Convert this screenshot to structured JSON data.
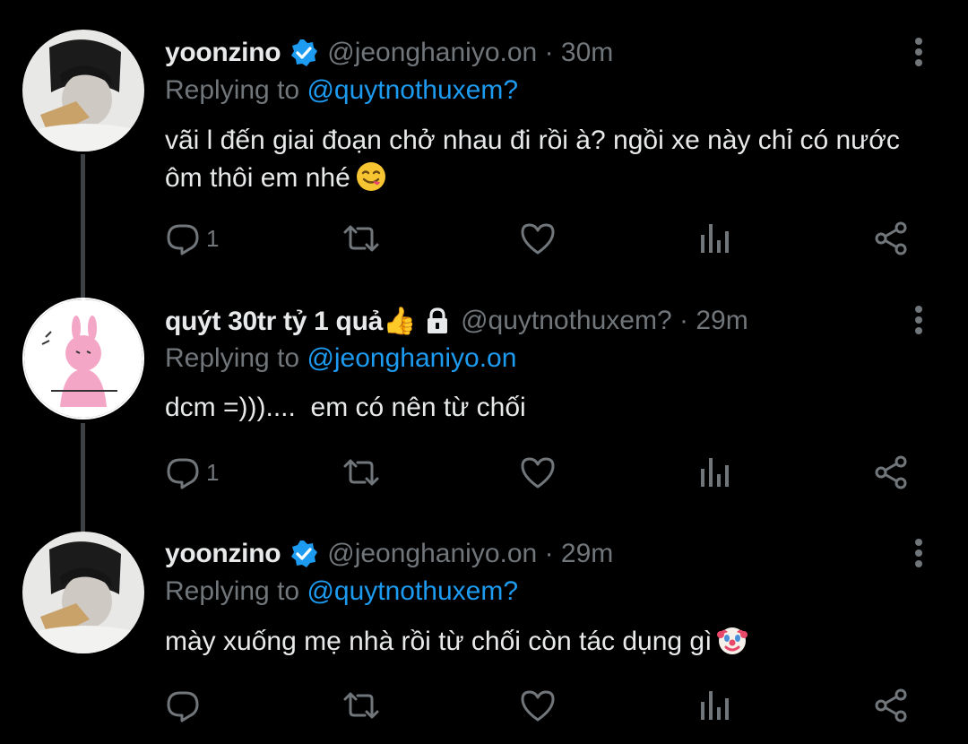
{
  "tweets": [
    {
      "display_name": "yoonzino",
      "handle": "@jeonghaniyo.on",
      "separator": "·",
      "time": "30m",
      "replying_prefix": "Replying to",
      "replying_to": "@quytnothuxem?",
      "text": "vãi l đến giai đoạn chở nhau đi rồi à? ngồi xe này chỉ có nước ôm thôi em nhé",
      "emoji": "savoring-face-emoji",
      "reply_count": "1",
      "verified": true
    },
    {
      "display_name": "quýt 30tr tỷ 1 quả👍",
      "handle": "@quytnothuxem?",
      "separator": "·",
      "time": "29m",
      "replying_prefix": "Replying to",
      "replying_to": "@jeonghaniyo.on",
      "text": "dcm =)))....  em có nên từ chối",
      "reply_count": "1",
      "protected": true
    },
    {
      "display_name": "yoonzino",
      "handle": "@jeonghaniyo.on",
      "separator": "·",
      "time": "29m",
      "replying_prefix": "Replying to",
      "replying_to": "@quytnothuxem?",
      "text": "mày xuống mẹ nhà rồi từ chối còn tác dụng gì",
      "emoji": "clown-face-emoji",
      "reply_count": "",
      "verified": true
    }
  ],
  "colors": {
    "background": "#000000",
    "text_primary": "#e7e9ea",
    "text_secondary": "#71767b",
    "accent": "#1d9bf0",
    "thread_line": "#3e4144"
  },
  "icons": {
    "reply": "reply-icon",
    "retweet": "retweet-icon",
    "like": "heart-icon",
    "analytics": "analytics-icon",
    "share": "share-icon",
    "more": "more-vertical-icon",
    "verified": "verified-badge-icon",
    "protected": "lock-icon"
  }
}
